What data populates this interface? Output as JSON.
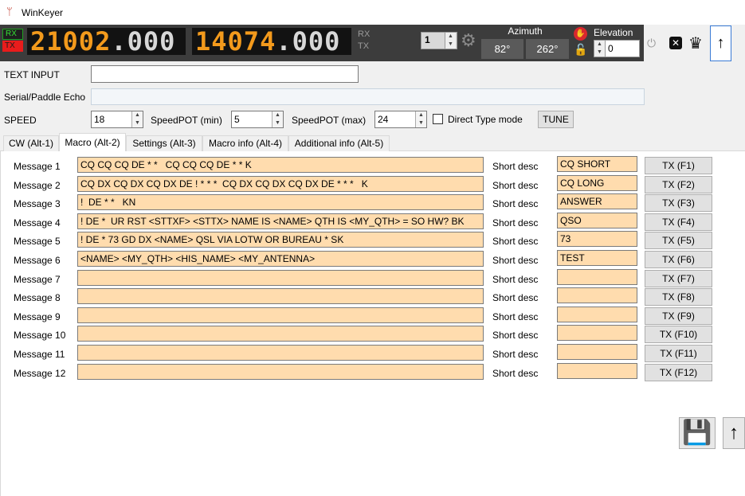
{
  "window": {
    "title": "WinKeyer"
  },
  "topbar": {
    "rx_label": "RX",
    "tx_label": "TX",
    "freq_a_hi": "21002",
    "freq_a_lo": ".000",
    "freq_b_hi": "14074",
    "freq_b_lo": ".000",
    "rx2_label": "RX",
    "tx2_label": "TX",
    "spin_value": "1",
    "azimuth_label": "Azimuth",
    "azimuth_1": "82°",
    "azimuth_2": "262°",
    "elevation_label": "Elevation",
    "elevation_value": "0"
  },
  "inputs": {
    "text_input_label": "TEXT INPUT",
    "text_input_value": "",
    "echo_label": "Serial/Paddle Echo",
    "echo_value": "",
    "speed_label": "SPEED",
    "speed_value": "18",
    "speedpot_min_label": "SpeedPOT (min)",
    "speedpot_min_value": "5",
    "speedpot_max_label": "SpeedPOT (max)",
    "speedpot_max_value": "24",
    "direct_type_label": "Direct Type mode",
    "tune_label": "TUNE"
  },
  "tabs": [
    {
      "label": "CW (Alt-1)"
    },
    {
      "label": "Macro (Alt-2)"
    },
    {
      "label": "Settings (Alt-3)"
    },
    {
      "label": "Macro info (Alt-4)"
    },
    {
      "label": "Additional info (Alt-5)"
    }
  ],
  "short_desc_label": "Short desc",
  "messages": [
    {
      "label": "Message 1",
      "text": "CQ CQ CQ DE * *   CQ CQ CQ DE * * K",
      "short": "CQ SHORT",
      "tx": "TX (F1)"
    },
    {
      "label": "Message 2",
      "text": "CQ DX CQ DX CQ DX DE ! * * *  CQ DX CQ DX CQ DX DE * * *   K",
      "short": "CQ LONG",
      "tx": "TX (F2)"
    },
    {
      "label": "Message 3",
      "text": "!  DE * *   KN",
      "short": "ANSWER",
      "tx": "TX (F3)"
    },
    {
      "label": "Message 4",
      "text": "! DE *  UR RST <STTXF> <STTX> NAME IS <NAME> QTH IS <MY_QTH> = SO HW? BK",
      "short": "QSO",
      "tx": "TX (F4)"
    },
    {
      "label": "Message 5",
      "text": "! DE * 73 GD DX <NAME> QSL VIA LOTW OR BUREAU * SK",
      "short": "73",
      "tx": "TX (F5)"
    },
    {
      "label": "Message 6",
      "text": "<NAME> <MY_QTH> <HIS_NAME> <MY_ANTENNA>",
      "short": "TEST",
      "tx": "TX (F6)"
    },
    {
      "label": "Message 7",
      "text": "",
      "short": "",
      "tx": "TX (F7)"
    },
    {
      "label": "Message 8",
      "text": "",
      "short": "",
      "tx": "TX (F8)"
    },
    {
      "label": "Message 9",
      "text": "",
      "short": "",
      "tx": "TX (F9)"
    },
    {
      "label": "Message 10",
      "text": "",
      "short": "",
      "tx": "TX (F10)"
    },
    {
      "label": "Message 11",
      "text": "",
      "short": "",
      "tx": "TX (F11)"
    },
    {
      "label": "Message 12",
      "text": "",
      "short": "",
      "tx": "TX (F12)"
    }
  ]
}
